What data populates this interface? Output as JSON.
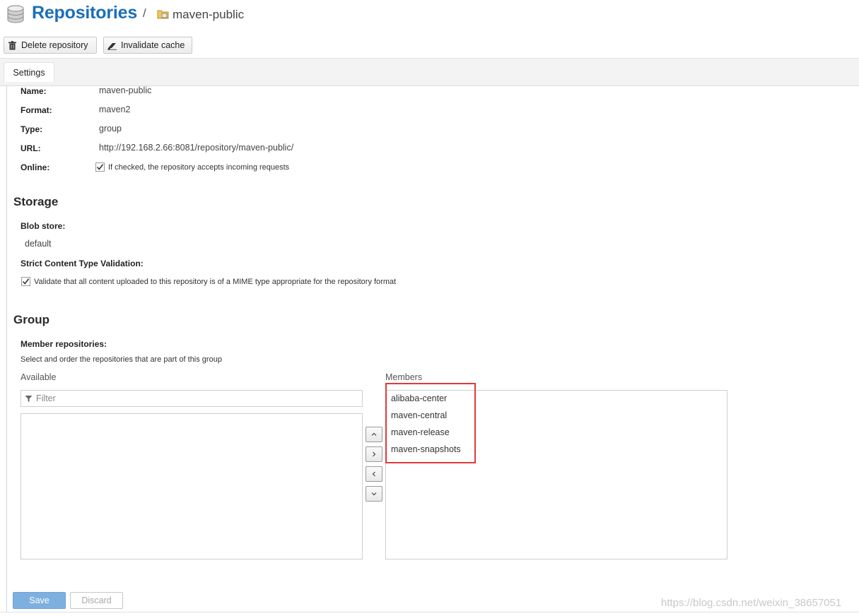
{
  "header": {
    "title": "Repositories",
    "separator": "/",
    "repo_name": "maven-public"
  },
  "toolbar": {
    "delete_label": "Delete repository",
    "invalidate_label": "Invalidate cache"
  },
  "tabs": [
    {
      "label": "Settings"
    }
  ],
  "settings": {
    "name_label": "Name:",
    "name_value": "maven-public",
    "format_label": "Format:",
    "format_value": "maven2",
    "type_label": "Type:",
    "type_value": "group",
    "url_label": "URL:",
    "url_value": "http://192.168.2.66:8081/repository/maven-public/",
    "online_label": "Online:",
    "online_text": "If checked, the repository accepts incoming requests"
  },
  "storage": {
    "heading": "Storage",
    "blob_label": "Blob store:",
    "blob_value": "default",
    "strict_label": "Strict Content Type Validation:",
    "strict_text": "Validate that all content uploaded to this repository is of a MIME type appropriate for the repository format"
  },
  "group": {
    "heading": "Group",
    "member_label": "Member repositories:",
    "member_help": "Select and order the repositories that are part of this group",
    "available_label": "Available",
    "filter_placeholder": "Filter",
    "members_label": "Members",
    "members": [
      "alibaba-center",
      "maven-central",
      "maven-release",
      "maven-snapshots"
    ]
  },
  "footer": {
    "save_label": "Save",
    "discard_label": "Discard"
  },
  "watermark": "https://blog.csdn.net/weixin_38657051",
  "colors": {
    "title_blue": "#1a6fb8",
    "save_blue": "#7db0df",
    "highlight_red": "#e03a3a"
  },
  "icons": [
    "database-icon",
    "folder-icon",
    "trash-icon",
    "eraser-icon",
    "filter-icon",
    "checkmark-icon",
    "chevron-up-icon",
    "chevron-right-icon",
    "chevron-left-icon",
    "chevron-down-icon"
  ]
}
